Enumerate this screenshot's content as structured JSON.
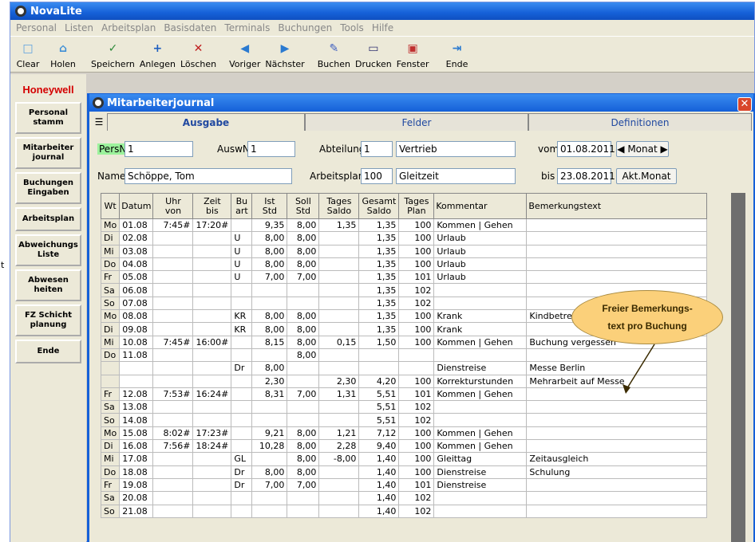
{
  "window_fragment": "t",
  "app": {
    "title": "NovaLite"
  },
  "menu": [
    "Personal",
    "Listen",
    "Arbeitsplan",
    "Basisdaten",
    "Terminals",
    "Buchungen",
    "Tools",
    "Hilfe"
  ],
  "toolbar": [
    {
      "label": "Clear",
      "icon": "clear-icon"
    },
    {
      "label": "Holen",
      "icon": "fetch-icon"
    },
    {
      "label": "Speichern",
      "icon": "save-icon"
    },
    {
      "label": "Anlegen",
      "icon": "add-icon"
    },
    {
      "label": "Löschen",
      "icon": "delete-icon"
    },
    {
      "label": "Voriger",
      "icon": "previous-icon"
    },
    {
      "label": "Nächster",
      "icon": "next-icon"
    },
    {
      "label": "Buchen",
      "icon": "book-icon"
    },
    {
      "label": "Drucken",
      "icon": "print-icon"
    },
    {
      "label": "Fenster",
      "icon": "window-icon"
    },
    {
      "label": "Ende",
      "icon": "exit-icon"
    }
  ],
  "sidebar": {
    "logo": "Honeywell",
    "items": [
      "Personal\nstamm",
      "Mitarbeiter\njournal",
      "Buchungen\nEingaben",
      "Arbeitsplan",
      "Abweichungs\nListe",
      "Abwesen\nheiten",
      "FZ Schicht\nplanung",
      "Ende"
    ]
  },
  "journal": {
    "title": "Mitarbeiterjournal",
    "tabs": [
      "Ausgabe",
      "Felder",
      "Definitionen"
    ],
    "form": {
      "persnr_label": "PersNr",
      "persnr": "1",
      "auswnr_label": "AuswNr",
      "auswnr": "1",
      "abteilung_label": "Abteilung",
      "abteilung_nr": "1",
      "abteilung_name": "Vertrieb",
      "vom_label": "vom",
      "vom": "01.08.2011",
      "monat_label": "Monat",
      "name_label": "Name",
      "name": "Schöppe, Tom",
      "arbeitsplan_label": "Arbeitsplan",
      "arbeitsplan_nr": "100",
      "arbeitsplan_name": "Gleitzeit",
      "bis_label": "bis",
      "bis": "23.08.2011",
      "akt_monat_button": "Akt.Monat"
    },
    "columns": [
      "Wt",
      "Datum",
      "Uhr\nvon",
      "Zeit\nbis",
      "Bu\nart",
      "Ist\nStd",
      "Soll\nStd",
      "Tages\nSaldo",
      "Gesamt\nSaldo",
      "Tages\nPlan",
      "Kommentar",
      "Bemerkungstext"
    ],
    "rows": [
      [
        "Mo",
        "01.08",
        "7:45#",
        "17:20#",
        "",
        "9,35",
        "8,00",
        "1,35",
        "1,35",
        "100",
        "Kommen | Gehen",
        ""
      ],
      [
        "Di",
        "02.08",
        "",
        "",
        "U",
        "8,00",
        "8,00",
        "",
        "1,35",
        "100",
        "Urlaub",
        ""
      ],
      [
        "Mi",
        "03.08",
        "",
        "",
        "U",
        "8,00",
        "8,00",
        "",
        "1,35",
        "100",
        "Urlaub",
        ""
      ],
      [
        "Do",
        "04.08",
        "",
        "",
        "U",
        "8,00",
        "8,00",
        "",
        "1,35",
        "100",
        "Urlaub",
        ""
      ],
      [
        "Fr",
        "05.08",
        "",
        "",
        "U",
        "7,00",
        "7,00",
        "",
        "1,35",
        "101",
        "Urlaub",
        ""
      ],
      [
        "Sa",
        "06.08",
        "",
        "",
        "",
        "",
        "",
        "",
        "1,35",
        "102",
        "",
        ""
      ],
      [
        "So",
        "07.08",
        "",
        "",
        "",
        "",
        "",
        "",
        "1,35",
        "102",
        "",
        ""
      ],
      [
        "Mo",
        "08.08",
        "",
        "",
        "KR",
        "8,00",
        "8,00",
        "",
        "1,35",
        "100",
        "Krank",
        "Kindbetreu"
      ],
      [
        "Di",
        "09.08",
        "",
        "",
        "KR",
        "8,00",
        "8,00",
        "",
        "1,35",
        "100",
        "Krank",
        ""
      ],
      [
        "Mi",
        "10.08",
        "7:45#",
        "16:00#",
        "",
        "8,15",
        "8,00",
        "0,15",
        "1,50",
        "100",
        "Kommen | Gehen",
        "Buchung vergessen"
      ],
      [
        "Do",
        "11.08",
        "",
        "",
        "",
        "",
        "8,00",
        "",
        "",
        "",
        "",
        ""
      ],
      [
        "",
        "",
        "",
        "",
        "Dr",
        "8,00",
        "",
        "",
        "",
        "",
        "Dienstreise",
        "Messe Berlin"
      ],
      [
        "",
        "",
        "",
        "",
        "",
        "2,30",
        "",
        "2,30",
        "4,20",
        "100",
        "Korrekturstunden",
        "Mehrarbeit auf Messe"
      ],
      [
        "Fr",
        "12.08",
        "7:53#",
        "16:24#",
        "",
        "8,31",
        "7,00",
        "1,31",
        "5,51",
        "101",
        "Kommen | Gehen",
        ""
      ],
      [
        "Sa",
        "13.08",
        "",
        "",
        "",
        "",
        "",
        "",
        "5,51",
        "102",
        "",
        ""
      ],
      [
        "So",
        "14.08",
        "",
        "",
        "",
        "",
        "",
        "",
        "5,51",
        "102",
        "",
        ""
      ],
      [
        "Mo",
        "15.08",
        "8:02#",
        "17:23#",
        "",
        "9,21",
        "8,00",
        "1,21",
        "7,12",
        "100",
        "Kommen | Gehen",
        ""
      ],
      [
        "Di",
        "16.08",
        "7:56#",
        "18:24#",
        "",
        "10,28",
        "8,00",
        "2,28",
        "9,40",
        "100",
        "Kommen | Gehen",
        ""
      ],
      [
        "Mi",
        "17.08",
        "",
        "",
        "GL",
        "",
        "8,00",
        "-8,00",
        "1,40",
        "100",
        "Gleittag",
        "Zeitausgleich"
      ],
      [
        "Do",
        "18.08",
        "",
        "",
        "Dr",
        "8,00",
        "8,00",
        "",
        "1,40",
        "100",
        "Dienstreise",
        "Schulung"
      ],
      [
        "Fr",
        "19.08",
        "",
        "",
        "Dr",
        "7,00",
        "7,00",
        "",
        "1,40",
        "101",
        "Dienstreise",
        ""
      ],
      [
        "Sa",
        "20.08",
        "",
        "",
        "",
        "",
        "",
        "",
        "1,40",
        "102",
        "",
        ""
      ],
      [
        "So",
        "21.08",
        "",
        "",
        "",
        "",
        "",
        "",
        "1,40",
        "102",
        "",
        ""
      ]
    ]
  },
  "callout": {
    "line1": "Freier Bemerkungs-",
    "line2": "text pro Buchung"
  }
}
